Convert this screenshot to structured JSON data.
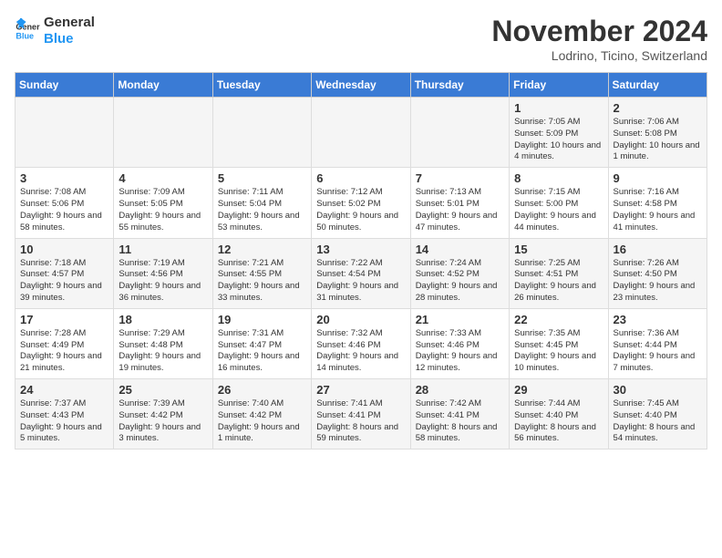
{
  "logo": {
    "line1": "General",
    "line2": "Blue"
  },
  "title": "November 2024",
  "location": "Lodrino, Ticino, Switzerland",
  "days_of_week": [
    "Sunday",
    "Monday",
    "Tuesday",
    "Wednesday",
    "Thursday",
    "Friday",
    "Saturday"
  ],
  "weeks": [
    [
      {
        "day": "",
        "info": ""
      },
      {
        "day": "",
        "info": ""
      },
      {
        "day": "",
        "info": ""
      },
      {
        "day": "",
        "info": ""
      },
      {
        "day": "",
        "info": ""
      },
      {
        "day": "1",
        "info": "Sunrise: 7:05 AM\nSunset: 5:09 PM\nDaylight: 10 hours and 4 minutes."
      },
      {
        "day": "2",
        "info": "Sunrise: 7:06 AM\nSunset: 5:08 PM\nDaylight: 10 hours and 1 minute."
      }
    ],
    [
      {
        "day": "3",
        "info": "Sunrise: 7:08 AM\nSunset: 5:06 PM\nDaylight: 9 hours and 58 minutes."
      },
      {
        "day": "4",
        "info": "Sunrise: 7:09 AM\nSunset: 5:05 PM\nDaylight: 9 hours and 55 minutes."
      },
      {
        "day": "5",
        "info": "Sunrise: 7:11 AM\nSunset: 5:04 PM\nDaylight: 9 hours and 53 minutes."
      },
      {
        "day": "6",
        "info": "Sunrise: 7:12 AM\nSunset: 5:02 PM\nDaylight: 9 hours and 50 minutes."
      },
      {
        "day": "7",
        "info": "Sunrise: 7:13 AM\nSunset: 5:01 PM\nDaylight: 9 hours and 47 minutes."
      },
      {
        "day": "8",
        "info": "Sunrise: 7:15 AM\nSunset: 5:00 PM\nDaylight: 9 hours and 44 minutes."
      },
      {
        "day": "9",
        "info": "Sunrise: 7:16 AM\nSunset: 4:58 PM\nDaylight: 9 hours and 41 minutes."
      }
    ],
    [
      {
        "day": "10",
        "info": "Sunrise: 7:18 AM\nSunset: 4:57 PM\nDaylight: 9 hours and 39 minutes."
      },
      {
        "day": "11",
        "info": "Sunrise: 7:19 AM\nSunset: 4:56 PM\nDaylight: 9 hours and 36 minutes."
      },
      {
        "day": "12",
        "info": "Sunrise: 7:21 AM\nSunset: 4:55 PM\nDaylight: 9 hours and 33 minutes."
      },
      {
        "day": "13",
        "info": "Sunrise: 7:22 AM\nSunset: 4:54 PM\nDaylight: 9 hours and 31 minutes."
      },
      {
        "day": "14",
        "info": "Sunrise: 7:24 AM\nSunset: 4:52 PM\nDaylight: 9 hours and 28 minutes."
      },
      {
        "day": "15",
        "info": "Sunrise: 7:25 AM\nSunset: 4:51 PM\nDaylight: 9 hours and 26 minutes."
      },
      {
        "day": "16",
        "info": "Sunrise: 7:26 AM\nSunset: 4:50 PM\nDaylight: 9 hours and 23 minutes."
      }
    ],
    [
      {
        "day": "17",
        "info": "Sunrise: 7:28 AM\nSunset: 4:49 PM\nDaylight: 9 hours and 21 minutes."
      },
      {
        "day": "18",
        "info": "Sunrise: 7:29 AM\nSunset: 4:48 PM\nDaylight: 9 hours and 19 minutes."
      },
      {
        "day": "19",
        "info": "Sunrise: 7:31 AM\nSunset: 4:47 PM\nDaylight: 9 hours and 16 minutes."
      },
      {
        "day": "20",
        "info": "Sunrise: 7:32 AM\nSunset: 4:46 PM\nDaylight: 9 hours and 14 minutes."
      },
      {
        "day": "21",
        "info": "Sunrise: 7:33 AM\nSunset: 4:46 PM\nDaylight: 9 hours and 12 minutes."
      },
      {
        "day": "22",
        "info": "Sunrise: 7:35 AM\nSunset: 4:45 PM\nDaylight: 9 hours and 10 minutes."
      },
      {
        "day": "23",
        "info": "Sunrise: 7:36 AM\nSunset: 4:44 PM\nDaylight: 9 hours and 7 minutes."
      }
    ],
    [
      {
        "day": "24",
        "info": "Sunrise: 7:37 AM\nSunset: 4:43 PM\nDaylight: 9 hours and 5 minutes."
      },
      {
        "day": "25",
        "info": "Sunrise: 7:39 AM\nSunset: 4:42 PM\nDaylight: 9 hours and 3 minutes."
      },
      {
        "day": "26",
        "info": "Sunrise: 7:40 AM\nSunset: 4:42 PM\nDaylight: 9 hours and 1 minute."
      },
      {
        "day": "27",
        "info": "Sunrise: 7:41 AM\nSunset: 4:41 PM\nDaylight: 8 hours and 59 minutes."
      },
      {
        "day": "28",
        "info": "Sunrise: 7:42 AM\nSunset: 4:41 PM\nDaylight: 8 hours and 58 minutes."
      },
      {
        "day": "29",
        "info": "Sunrise: 7:44 AM\nSunset: 4:40 PM\nDaylight: 8 hours and 56 minutes."
      },
      {
        "day": "30",
        "info": "Sunrise: 7:45 AM\nSunset: 4:40 PM\nDaylight: 8 hours and 54 minutes."
      }
    ]
  ]
}
